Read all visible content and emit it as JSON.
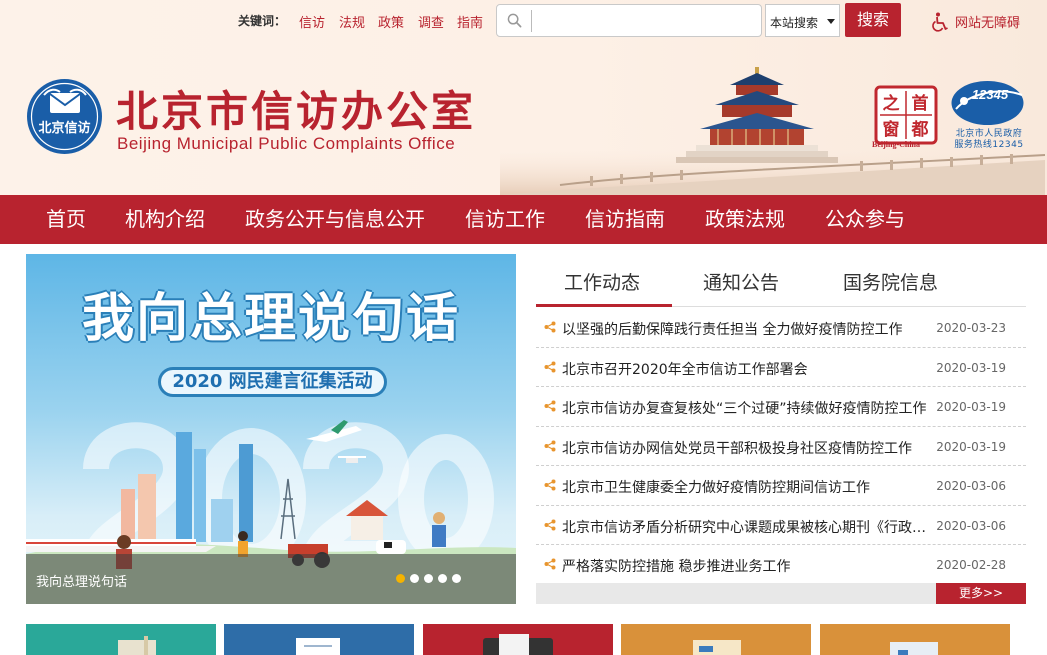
{
  "topbar": {
    "keywords_label": "关键词：",
    "keywords": [
      "信访",
      "法规",
      "政策",
      "调查",
      "指南"
    ],
    "search_placeholder": "",
    "scope_selected": "本站搜索",
    "search_button": "搜索",
    "accessibility": "网站无障碍"
  },
  "brand": {
    "title_cn": "北京市信访办公室",
    "title_en": "Beijing Municipal Public Complaints Office",
    "emblem_text": "北京信访",
    "seal_chars": [
      "之",
      "首",
      "窗",
      "都"
    ],
    "seal_caption": "Beijing-China",
    "hotline_number": "12345",
    "hotline_caption_1": "北京市人民政府",
    "hotline_caption_2": "服务热线12345"
  },
  "nav": [
    "首页",
    "机构介绍",
    "政务公开与信息公开",
    "信访工作",
    "信访指南",
    "政策法规",
    "公众参与"
  ],
  "carousel": {
    "slogan": "我向总理说句话",
    "event": "2020 网民建言征集活动",
    "caption": "我向总理说句话",
    "slide_count": 5,
    "active_slide": 1
  },
  "news": {
    "tabs": [
      "工作动态",
      "通知公告",
      "国务院信息"
    ],
    "active_tab": 0,
    "items": [
      {
        "title": "以坚强的后勤保障践行责任担当 全力做好疫情防控工作",
        "date": "2020-03-23"
      },
      {
        "title": "北京市召开2020年全市信访工作部署会",
        "date": "2020-03-19"
      },
      {
        "title": "北京市信访办复查复核处“三个过硬”持续做好疫情防控工作",
        "date": "2020-03-19"
      },
      {
        "title": "北京市信访办网信处党员干部积极投身社区疫情防控工作",
        "date": "2020-03-19"
      },
      {
        "title": "北京市卫生健康委全力做好疫情防控期间信访工作",
        "date": "2020-03-06"
      },
      {
        "title": "北京市信访矛盾分析研究中心课题成果被核心期刊《行政管理改革》刊发",
        "date": "2020-03-06"
      },
      {
        "title": "严格落实防控措施 稳步推进业务工作",
        "date": "2020-02-28"
      }
    ],
    "more": "更多>>"
  },
  "colors": {
    "brand_red": "#b8232f",
    "tile_colors": [
      "#2aa899",
      "#2e6da8",
      "#b8232f",
      "#d9913a",
      "#d9913a"
    ]
  }
}
